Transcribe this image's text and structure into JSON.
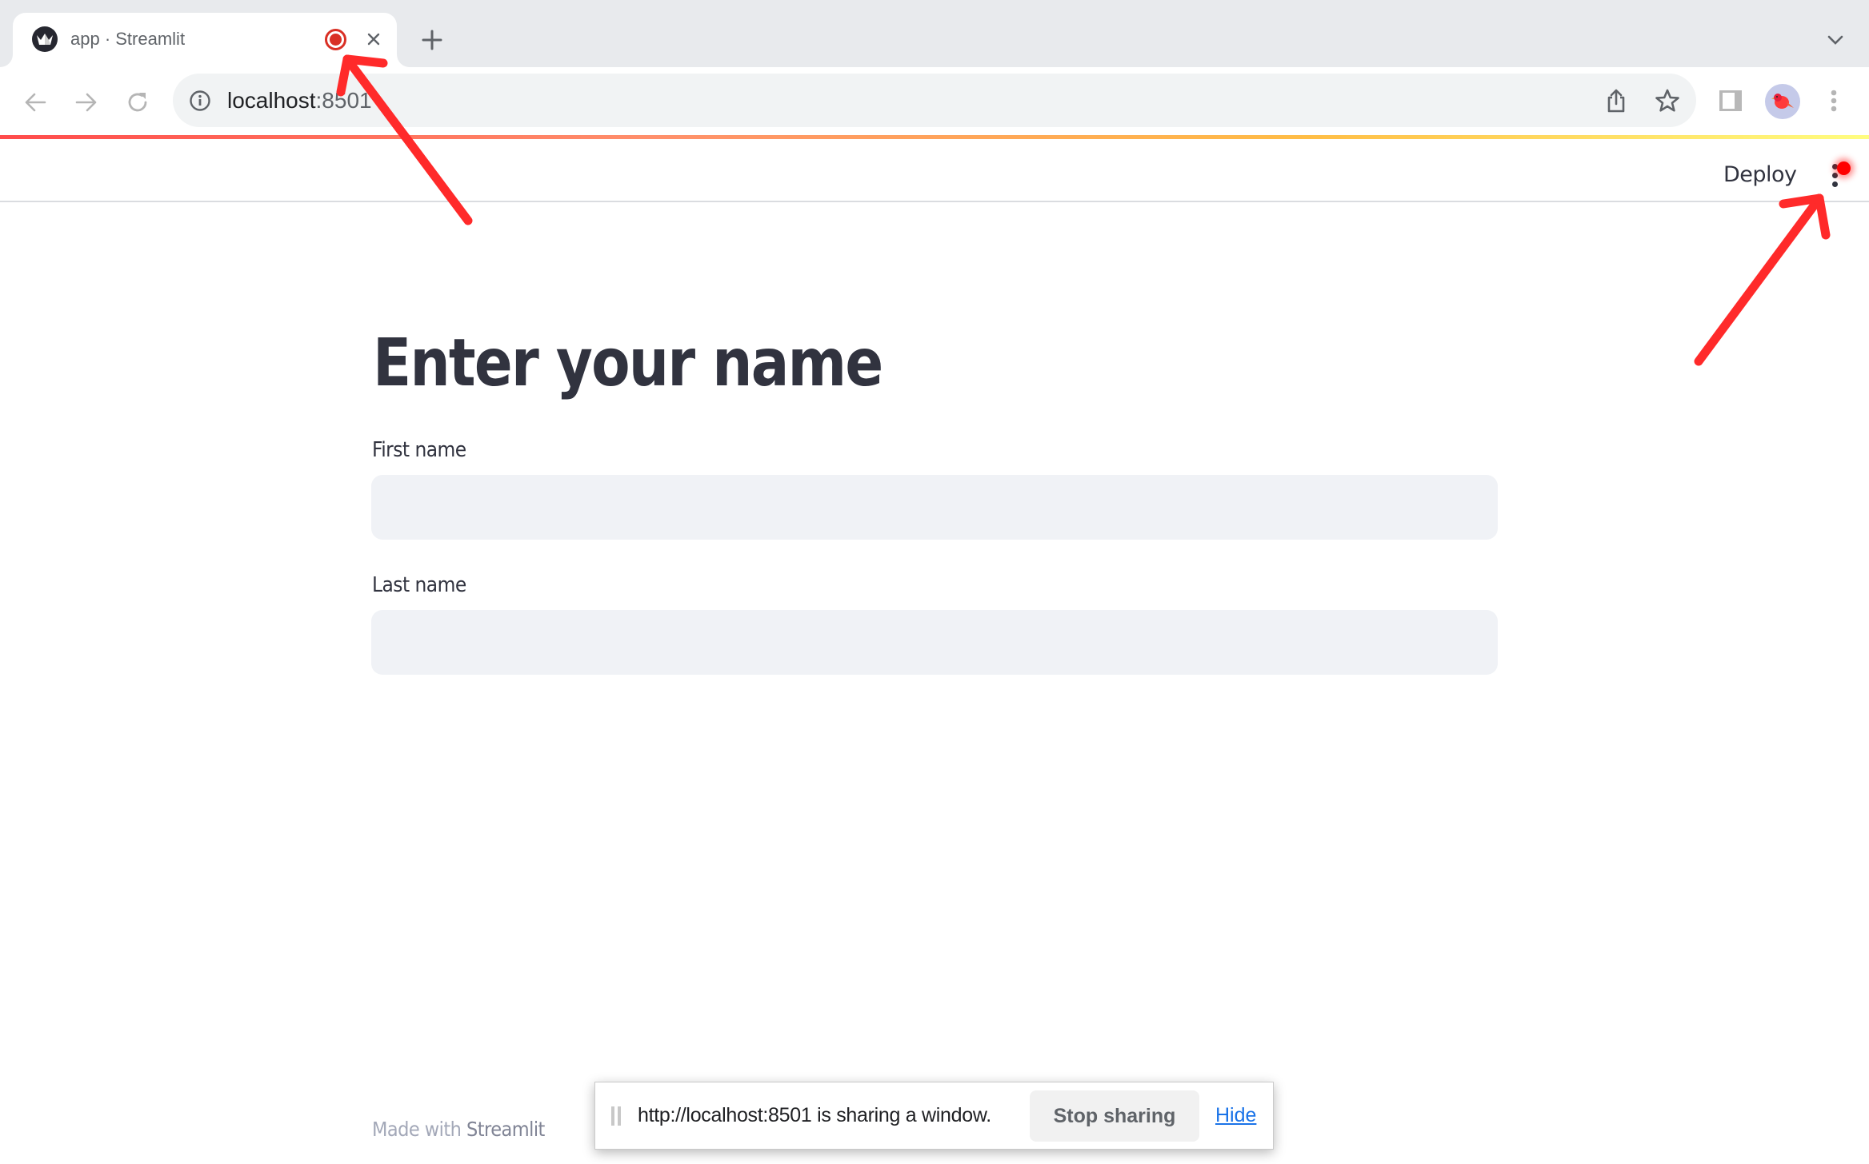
{
  "browser": {
    "tab": {
      "title": "app · Streamlit",
      "favicon": "streamlit-crown-icon",
      "recording_indicator": "recording-icon",
      "close_icon": "close-icon"
    },
    "new_tab_icon": "plus-icon",
    "tab_search_icon": "chevron-down-icon",
    "toolbar": {
      "back_icon": "arrow-left-icon",
      "forward_icon": "arrow-right-icon",
      "reload_icon": "reload-icon",
      "site_info_icon": "info-icon",
      "url_host": "localhost",
      "url_port": ":8501",
      "share_icon": "share-icon",
      "bookmark_icon": "star-icon",
      "side_panel_icon": "side-panel-icon",
      "profile_avatar": "bird-avatar",
      "menu_icon": "vertical-dots-icon"
    }
  },
  "app": {
    "header": {
      "deploy_label": "Deploy",
      "main_menu_icon": "vertical-dots-icon"
    },
    "title": "Enter your name",
    "fields": [
      {
        "label": "First name",
        "value": "",
        "placeholder": ""
      },
      {
        "label": "Last name",
        "value": "",
        "placeholder": ""
      }
    ],
    "footer": {
      "prefix": "Made with ",
      "brand": "Streamlit"
    },
    "colors": {
      "accent_gradient": [
        "#ff4b4b",
        "#ffbd45",
        "#fffd80"
      ],
      "text": "#31333f",
      "input_bg": "#f0f2f6"
    }
  },
  "share_bar": {
    "message": "http://localhost:8501 is sharing a window.",
    "stop_label": "Stop sharing",
    "hide_label": "Hide"
  },
  "annotations": {
    "color": "#ff2a2a",
    "arrows": [
      {
        "target": "tab-recording-indicator"
      },
      {
        "target": "app-main-menu"
      }
    ]
  }
}
